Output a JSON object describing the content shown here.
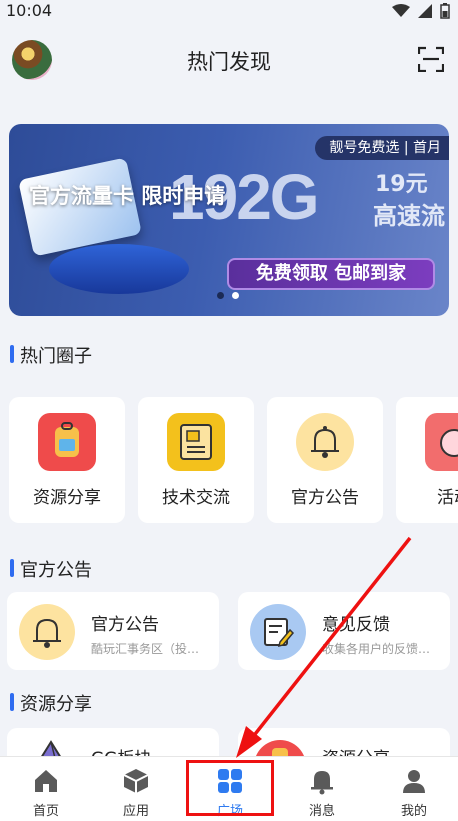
{
  "status": {
    "time": "10:04"
  },
  "header": {
    "title": "热门发现"
  },
  "banner": {
    "headline": "官方流量卡 限时申请",
    "tag": "靓号免费选 | 首月",
    "big_text": "192G",
    "price": "19元",
    "sub": "高速流",
    "button": "免费领取 包邮到家"
  },
  "sections": {
    "circles": "热门圈子",
    "notices": "官方公告",
    "resources": "资源分享"
  },
  "circles": [
    {
      "label": "资源分享",
      "color": "#ef4b4b",
      "icon": "backpack-icon"
    },
    {
      "label": "技术交流",
      "color": "#f3c11c",
      "icon": "notebook-icon"
    },
    {
      "label": "官方公告",
      "color": "#fde3a0",
      "icon": "bell-icon"
    },
    {
      "label": "活动",
      "color": "#f26d6d",
      "icon": "gift-icon"
    }
  ],
  "notices": [
    {
      "title": "官方公告",
      "desc": "酷玩汇事务区（投…",
      "color": "#fde3a0",
      "icon": "bell-icon"
    },
    {
      "title": "意见反馈",
      "desc": "收集各用户的反馈…",
      "color": "#a9c9f2",
      "icon": "feedback-icon"
    }
  ],
  "resources": [
    {
      "title": "GG板块",
      "icon": "diamond-icon"
    },
    {
      "title": "资源分享",
      "icon": "backpack-icon"
    }
  ],
  "tabs": [
    {
      "label": "首页",
      "icon": "home-icon"
    },
    {
      "label": "应用",
      "icon": "box-icon"
    },
    {
      "label": "广场",
      "icon": "grid-icon",
      "active": true
    },
    {
      "label": "消息",
      "icon": "bell-icon"
    },
    {
      "label": "我的",
      "icon": "person-icon"
    }
  ],
  "colors": {
    "accent": "#2f7bf0",
    "annotation": "#e11111"
  }
}
